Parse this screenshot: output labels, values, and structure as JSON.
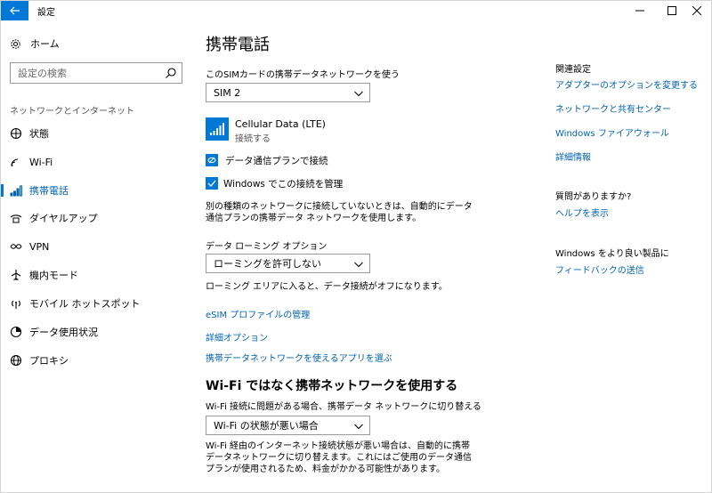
{
  "window": {
    "title": "設定"
  },
  "sidebar": {
    "home_label": "ホーム",
    "search_placeholder": "設定の検索",
    "section_label": "ネットワークとインターネット",
    "items": [
      {
        "label": "状態",
        "icon": "globe-status-icon"
      },
      {
        "label": "Wi-Fi",
        "icon": "wifi-icon"
      },
      {
        "label": "携帯電話",
        "icon": "cellular-icon",
        "active": true
      },
      {
        "label": "ダイヤルアップ",
        "icon": "dialup-icon"
      },
      {
        "label": "VPN",
        "icon": "vpn-icon"
      },
      {
        "label": "機内モード",
        "icon": "airplane-icon"
      },
      {
        "label": "モバイル ホットスポット",
        "icon": "hotspot-icon"
      },
      {
        "label": "データ使用状況",
        "icon": "data-usage-icon"
      },
      {
        "label": "プロキシ",
        "icon": "globe-icon"
      }
    ]
  },
  "main": {
    "title": "携帯電話",
    "sim_label": "このSIMカードの携帯データネットワークを使う",
    "sim_value": "SIM 2",
    "network_name": "Cellular Data (LTE)",
    "network_status": "接続する",
    "plan_label": "データ通信プランで接続",
    "manage_checkbox_label": "Windows でこの接続を管理",
    "manage_checked": true,
    "desc1": "別の種類のネットワークに接続していないときは、自動的にデータ通信プランの携帯データ ネットワークを使用します。",
    "roaming_label": "データ ローミング オプション",
    "roaming_value": "ローミングを許可しない",
    "roaming_desc": "ローミング エリアに入ると、データ接続がオフになります。",
    "esim_link": "eSIM プロファイルの管理",
    "advanced_link": "詳細オプション",
    "apps_link": "携帯データネットワークを使えるアプリを選ぶ",
    "wifi_section_title": "Wi-Fi ではなく携帯ネットワークを使用する",
    "wifi_switch_label": "Wi-Fi 接続に問題がある場合、携帯データ ネットワークに切り替える",
    "wifi_switch_value": "Wi-Fi の状態が悪い場合",
    "wifi_desc": "Wi-Fi 経由のインターネット接続状態が悪い場合は、自動的に携帯データネットワークに切り替えます。これにはご使用のデータ通信プランが使用されるため、料金がかかる可能性があります。"
  },
  "right": {
    "related_title": "関連設定",
    "related_links": [
      "アダプターのオプションを変更する",
      "ネットワークと共有センター",
      "Windows ファイアウォール",
      "詳細情報"
    ],
    "question_title": "質問がありますか?",
    "help_link": "ヘルプを表示",
    "improve_title": "Windows をより良い製品に",
    "feedback_link": "フィードバックの送信"
  },
  "colors": {
    "accent": "#0078d7",
    "link": "#0063b1"
  }
}
